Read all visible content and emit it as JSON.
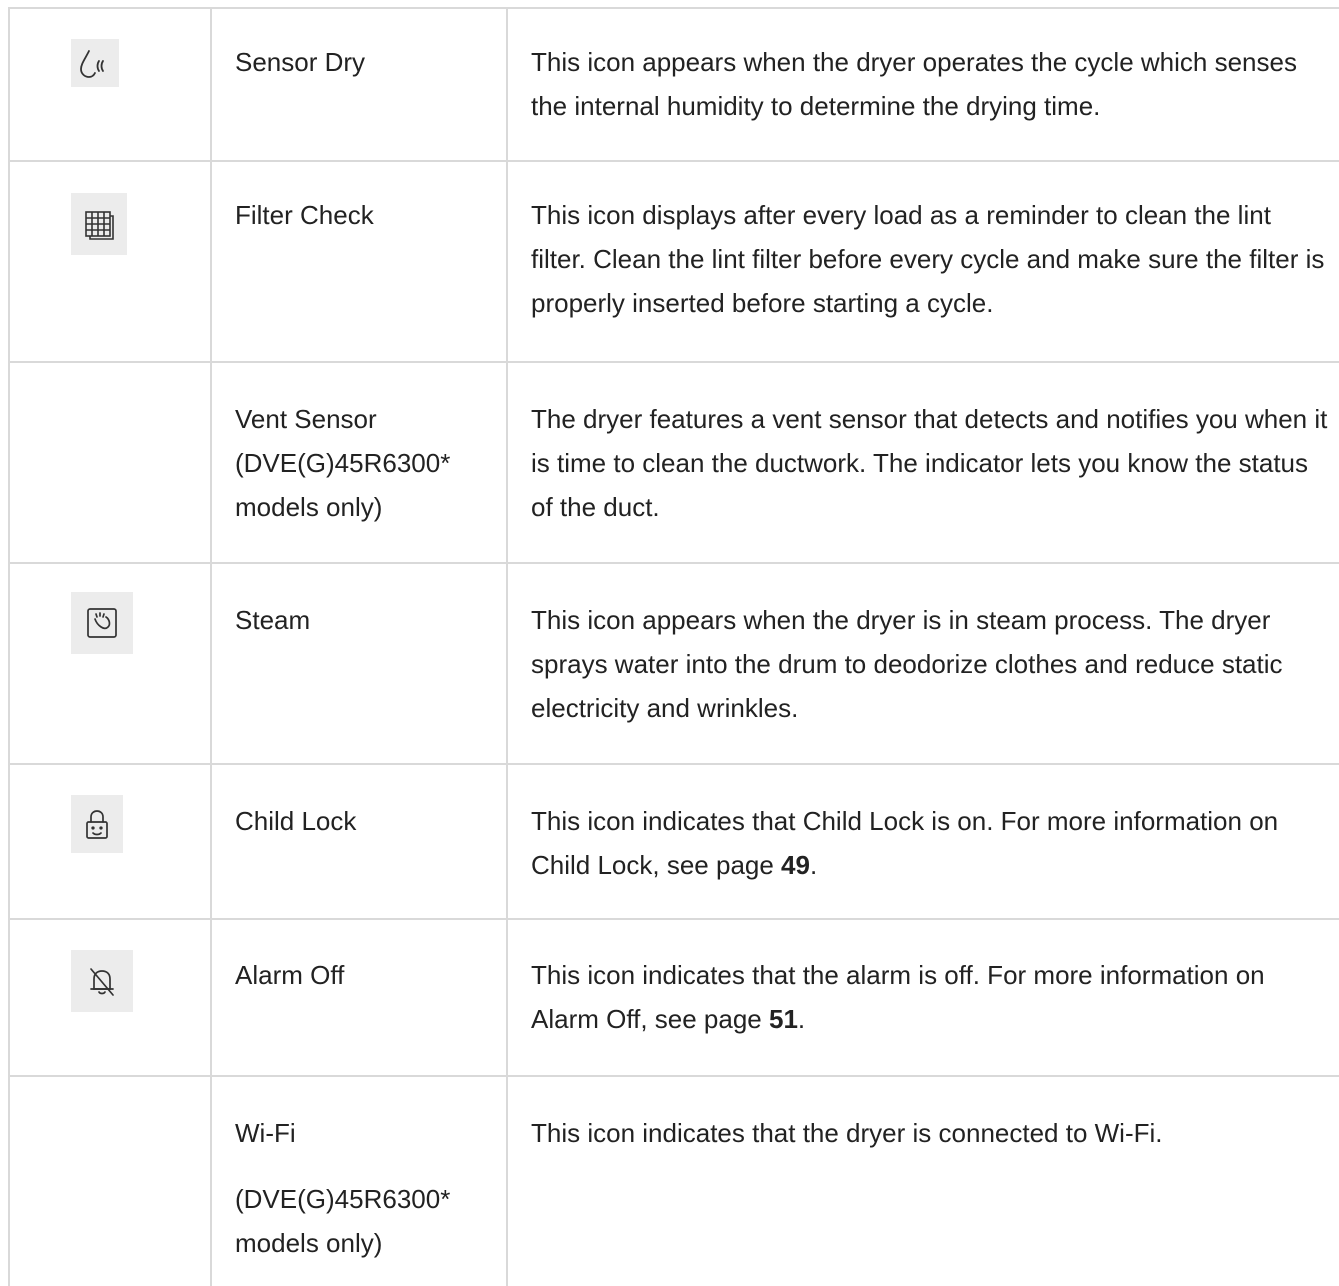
{
  "rows": [
    {
      "icon": "sensor-dry-icon",
      "name": "Sensor Dry",
      "description": "This icon appears when the dryer operates the cycle which senses the internal humidity to determine the drying time."
    },
    {
      "icon": "filter-check-icon",
      "name": "Filter Check",
      "description": "This icon displays after every load as a reminder to clean the lint filter. Clean the lint filter before every cycle and make sure the filter is properly inserted before starting a cycle."
    },
    {
      "icon": "",
      "name": "Vent Sensor (DVE(G)45R6300* models only)",
      "description": "The dryer features a vent sensor that detects and notifies you when it is time to clean the ductwork. The indicator lets you know the status of the duct."
    },
    {
      "icon": "steam-icon",
      "name": "Steam",
      "description": "This icon appears when the dryer is in steam process. The dryer sprays water into the drum to deodorize clothes and reduce static electricity and wrinkles."
    },
    {
      "icon": "child-lock-icon",
      "name": "Child Lock",
      "description_before": "This icon indicates that Child Lock is on. For more information on Child Lock, see page ",
      "page": "49",
      "description_after": "."
    },
    {
      "icon": "alarm-off-icon",
      "name": "Alarm Off",
      "description_before": "This icon indicates that the alarm is off. For more information on Alarm Off, see page ",
      "page": "51",
      "description_after": "."
    },
    {
      "icon": "",
      "name": "Wi-Fi",
      "name_sub": "(DVE(G)45R6300* models only)",
      "description": "This icon indicates that the dryer is connected to Wi-Fi."
    }
  ]
}
